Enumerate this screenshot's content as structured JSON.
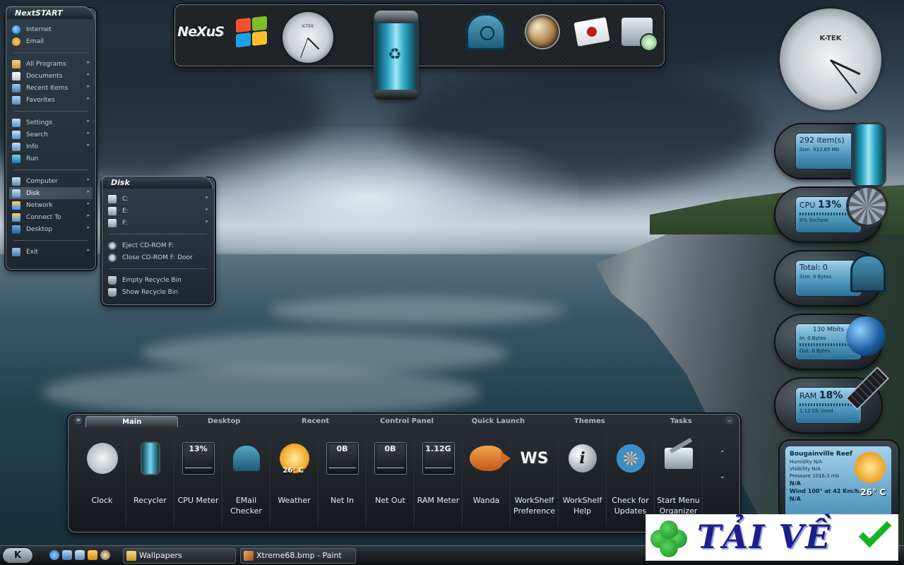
{
  "nextstart": {
    "title": "NextSTART",
    "groups": [
      [
        {
          "label": "Internet",
          "icon": "internet-explorer-icon"
        },
        {
          "label": "Email",
          "icon": "email-icon"
        }
      ],
      [
        {
          "label": "All Programs",
          "icon": "folder-icon"
        },
        {
          "label": "Documents",
          "icon": "documents-icon"
        },
        {
          "label": "Recent Items",
          "icon": "recent-items-icon"
        },
        {
          "label": "Favorites",
          "icon": "favorites-icon"
        }
      ],
      [
        {
          "label": "Settings",
          "icon": "settings-icon"
        },
        {
          "label": "Search",
          "icon": "search-icon"
        },
        {
          "label": "Info",
          "icon": "info-icon"
        },
        {
          "label": "Run",
          "icon": "run-icon"
        }
      ],
      [
        {
          "label": "Computer",
          "icon": "computer-icon"
        },
        {
          "label": "Disk",
          "icon": "disk-icon"
        },
        {
          "label": "Network",
          "icon": "network-icon"
        },
        {
          "label": "Connect To",
          "icon": "connect-icon"
        },
        {
          "label": "Desktop",
          "icon": "desktop-icon"
        }
      ],
      [
        {
          "label": "Exit",
          "icon": "exit-icon"
        }
      ]
    ]
  },
  "disk_menu": {
    "title": "Disk",
    "drives": [
      "C:",
      "E:",
      "F:"
    ],
    "cd_actions": [
      "Eject CD-ROM F:",
      "Close CD-ROM F: Door"
    ],
    "bin_actions": [
      "Empty Recycle Bin",
      "Show Recycle Bin"
    ]
  },
  "top_dock": {
    "nexus_label": "NeXuS",
    "clock_brand": "K-TEK"
  },
  "kteck_clock": {
    "brand": "K-TEK"
  },
  "gadgets": {
    "recycler": {
      "big": "292 item(s)",
      "small": "Size: 933.85 Mb"
    },
    "cpu": {
      "label": "CPU",
      "value": "13%",
      "small": "9% Svchost"
    },
    "email": {
      "big": "Total: 0",
      "small": "Size: 0 Bytes"
    },
    "net": {
      "big": "130 Mbits",
      "in": "In: 0 Bytes",
      "out": "Out: 0 Bytes"
    },
    "ram": {
      "label": "RAM",
      "value": "18%",
      "small": "1.12 Gb Used"
    }
  },
  "weather": {
    "location": "Bougainville Reef",
    "humidity": "Humidity N/A",
    "visibility": "Visibility N/A",
    "pressure": "Pressure 1016.3 mb",
    "na1": "N/A",
    "wind": "Wind 100° at 42 Km/h.",
    "na2": "N/A",
    "temp": "26° C"
  },
  "workshelf": {
    "tabs": [
      "Main",
      "Desktop",
      "Recent",
      "Control Panel",
      "Quick Launch",
      "Themes",
      "Tasks"
    ],
    "active_tab": "Main",
    "items": [
      {
        "label": "Clock"
      },
      {
        "label": "Recycler"
      },
      {
        "label": "CPU Meter",
        "value": "13%"
      },
      {
        "label": "EMail Checker"
      },
      {
        "label": "Weather",
        "value": "26° C"
      },
      {
        "label": "Net In",
        "value": "0B"
      },
      {
        "label": "Net Out",
        "value": "0B"
      },
      {
        "label": "RAM Meter",
        "value": "1.12G"
      },
      {
        "label": "Wanda"
      },
      {
        "label": "WorkShelf Preference"
      },
      {
        "label": "WorkShelf Help"
      },
      {
        "label": "Check for Updates"
      },
      {
        "label": "Start Menu Organizer"
      }
    ]
  },
  "taskbar": {
    "start_label": "K",
    "tasks": [
      "Wallpapers",
      "Xtreme68.bmp - Paint"
    ]
  },
  "watermark": {
    "text": "TẢI VỀ"
  },
  "colors": {
    "panel_dark": "#1d2730",
    "panel_border": "#6a7782",
    "lcd_blue": "#4f97bd",
    "menu_active": "#4c5a66"
  }
}
